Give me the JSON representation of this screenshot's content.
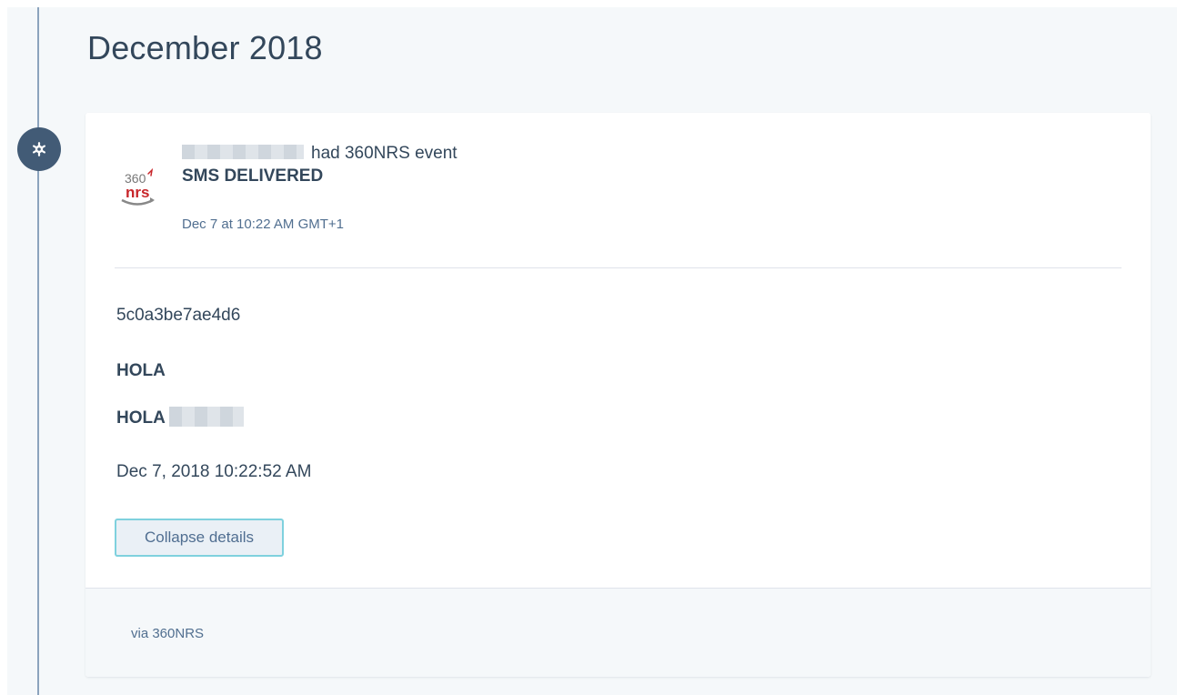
{
  "timeline": {
    "month_heading": "December 2018",
    "marker_icon": "gear-icon"
  },
  "event": {
    "actor_text": "had 360NRS event",
    "event_type": "SMS DELIVERED",
    "timestamp": "Dec 7 at 10:22 AM GMT+1",
    "source_logo": {
      "top_text": "360",
      "bottom_text": "nrs",
      "color": "#c8262b"
    },
    "details": {
      "message_id": "5c0a3be7ae4d6",
      "sender": "HOLA",
      "message_text": "HOLA",
      "delivered_at": "Dec 7, 2018 10:22:52 AM"
    },
    "collapse_button_label": "Collapse details",
    "via_text": "via 360NRS"
  },
  "colors": {
    "background": "#f5f8fa",
    "text": "#33475b",
    "muted_text": "#516f90",
    "timeline_marker": "#425b76",
    "button_border": "#7fd1de"
  }
}
